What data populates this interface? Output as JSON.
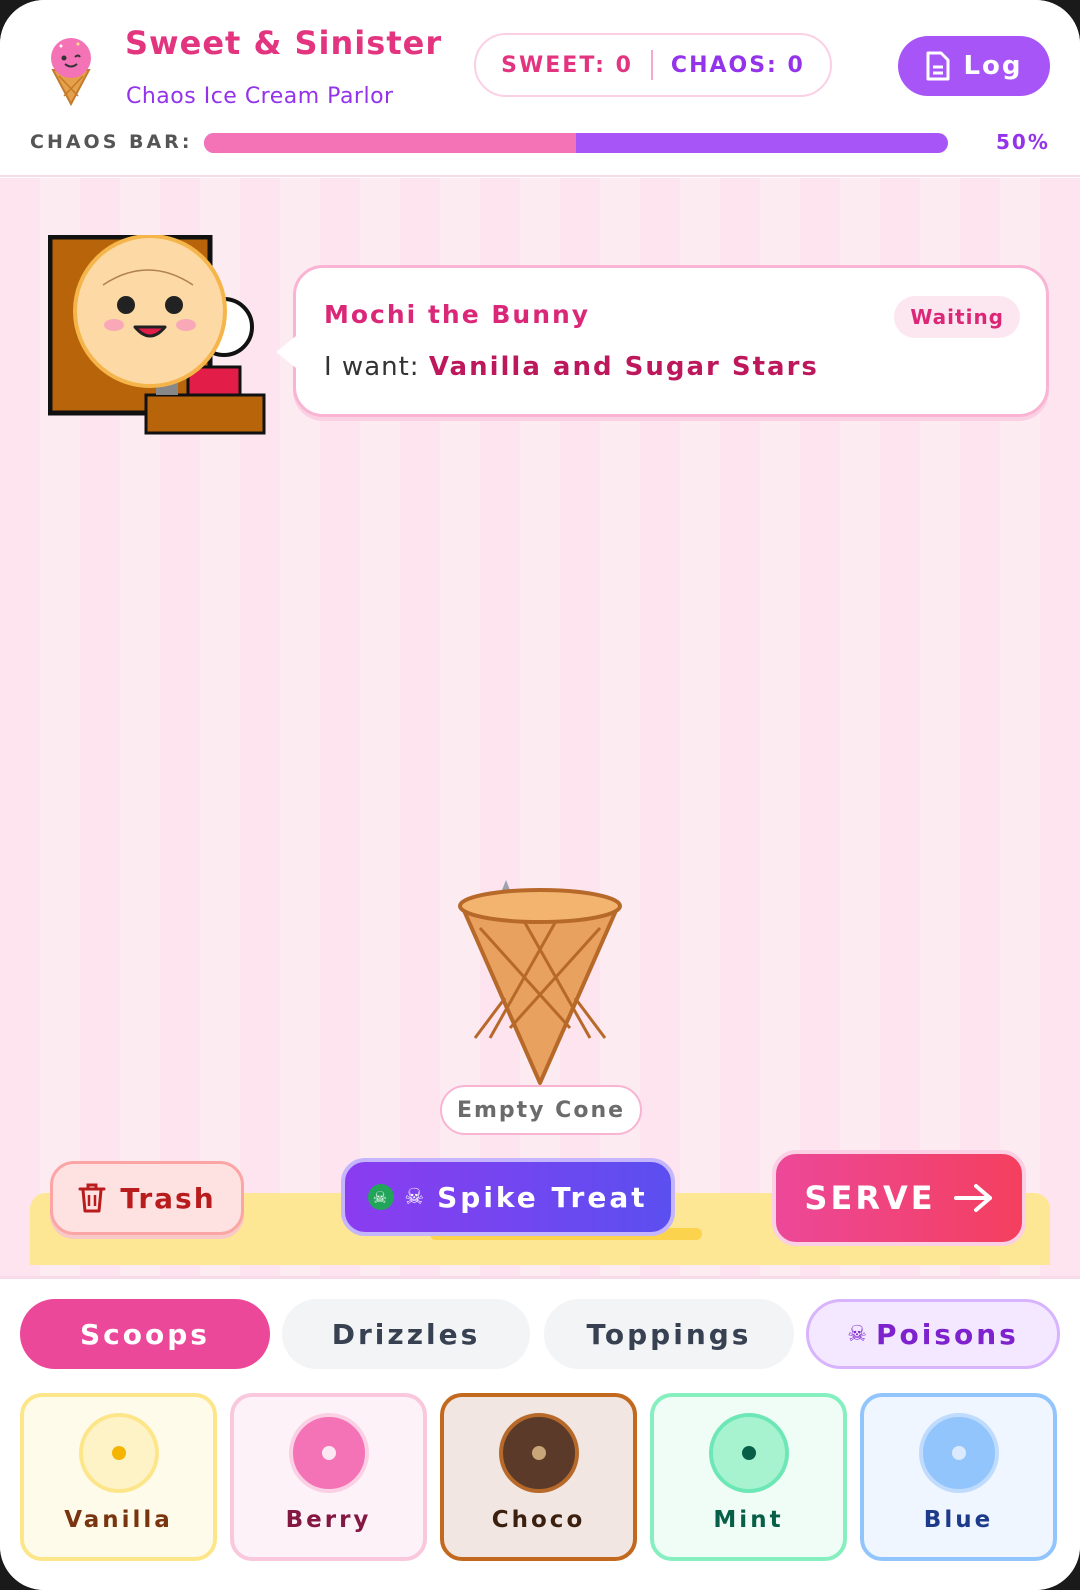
{
  "header": {
    "title": "Sweet & Sinister",
    "subtitle": "Chaos Ice Cream Parlor",
    "sweet_label": "SWEET:",
    "sweet_value": "0",
    "chaos_label": "CHAOS:",
    "chaos_value": "0",
    "log_label": "Log",
    "chaos_bar_label": "CHAOS BAR:",
    "chaos_percent_text": "50%",
    "chaos_level": 0.5
  },
  "customer": {
    "name": "Mochi the Bunny",
    "status": "Waiting",
    "want_prefix": "I want:",
    "order": "Vanilla and Sugar Stars"
  },
  "cone": {
    "label": "Empty Cone"
  },
  "actions": {
    "trash_label": "Trash",
    "spike_label": "Spike Treat",
    "serve_label": "SERVE"
  },
  "tabs": [
    {
      "label": "Scoops",
      "active": true
    },
    {
      "label": "Drizzles",
      "active": false
    },
    {
      "label": "Toppings",
      "active": false
    },
    {
      "label": "Poisons",
      "active": false
    }
  ],
  "scoops": [
    {
      "label": "Vanilla",
      "color": "#fef3c7"
    },
    {
      "label": "Berry",
      "color": "#f472b6"
    },
    {
      "label": "Choco",
      "color": "#5b3a29"
    },
    {
      "label": "Mint",
      "color": "#a7f3d0"
    },
    {
      "label": "Blue",
      "color": "#93c5fd"
    }
  ],
  "colors": {
    "brand_pink": "#e3357f",
    "brand_purple": "#9333ea",
    "serve_red": "#f43f5e"
  }
}
